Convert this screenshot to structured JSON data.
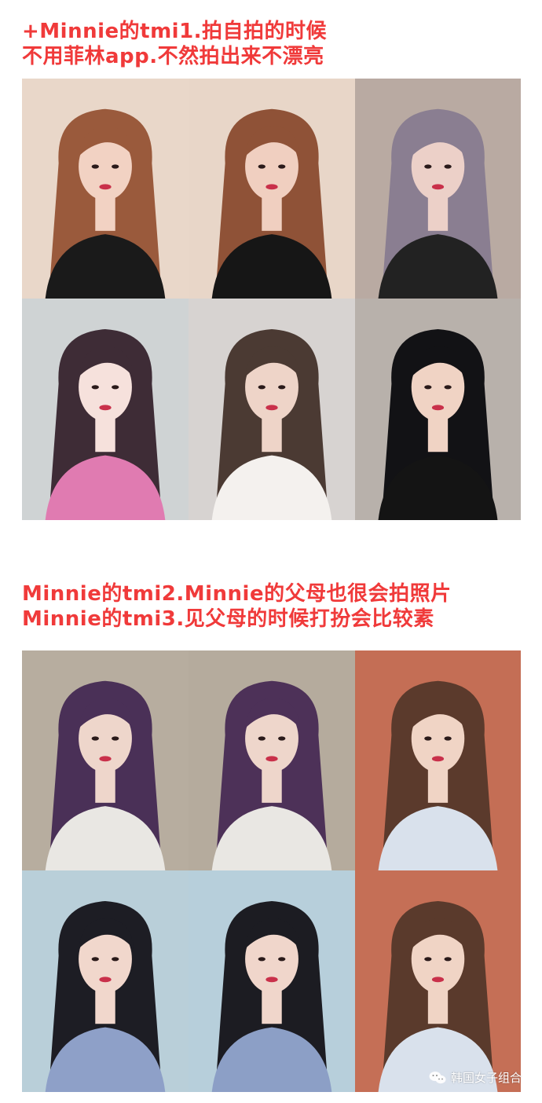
{
  "captions": {
    "line1": "+Minnie的tmi1.拍自拍的时候",
    "line2": "不用菲林app.不然拍出来不漂亮",
    "line3": "Minnie的tmi2.Minnie的父母也很会拍照片",
    "line4": "Minnie的tmi3.见父母的时候打扮会比较素"
  },
  "watermark": {
    "text": "韩国女子组合"
  },
  "colors": {
    "caption": "#f03a3a"
  },
  "grid1_photos": [
    {
      "name": "selfie-1",
      "bg": "#e9d7c9",
      "hair": "#9a5a3c",
      "skin": "#f2d2c3",
      "top": "#1a1a1a"
    },
    {
      "name": "selfie-2",
      "bg": "#e8d6c8",
      "hair": "#8f5237",
      "skin": "#f0cfc0",
      "top": "#161616"
    },
    {
      "name": "selfie-3",
      "bg": "#b9aaa2",
      "hair": "#8a7e91",
      "skin": "#ecd0c8",
      "top": "#222222"
    },
    {
      "name": "selfie-4",
      "bg": "#cfd3d4",
      "hair": "#3e2c36",
      "skin": "#f6e1dc",
      "top": "#e07bb1"
    },
    {
      "name": "selfie-5",
      "bg": "#d7d3d1",
      "hair": "#4b3a33",
      "skin": "#eed4c8",
      "top": "#f4f1ee"
    },
    {
      "name": "selfie-6",
      "bg": "#b8b1ab",
      "hair": "#121215",
      "skin": "#f0d3c4",
      "top": "#141414"
    }
  ],
  "grid2_photos": [
    {
      "name": "parents-photo-1",
      "bg": "#b7ad9f",
      "hair": "#4a3057",
      "skin": "#eed6cb",
      "top": "#e9e7e3"
    },
    {
      "name": "parents-photo-2",
      "bg": "#b5ab9d",
      "hair": "#4d3158",
      "skin": "#eed6cb",
      "top": "#e9e7e3"
    },
    {
      "name": "parents-photo-3",
      "bg": "#c46e55",
      "hair": "#5b3a2c",
      "skin": "#f0d4c5",
      "top": "#d9e1ec"
    },
    {
      "name": "parents-photo-4",
      "bg": "#b9cfd9",
      "hair": "#1d1d24",
      "skin": "#f1d7cc",
      "top": "#8ea0c8"
    },
    {
      "name": "parents-photo-5",
      "bg": "#b7cfdb",
      "hair": "#1c1c22",
      "skin": "#f0d6cb",
      "top": "#8c9fc6"
    },
    {
      "name": "parents-photo-6",
      "bg": "#c56f56",
      "hair": "#5a3a2c",
      "skin": "#f0d4c5",
      "top": "#d9e1ec"
    }
  ]
}
